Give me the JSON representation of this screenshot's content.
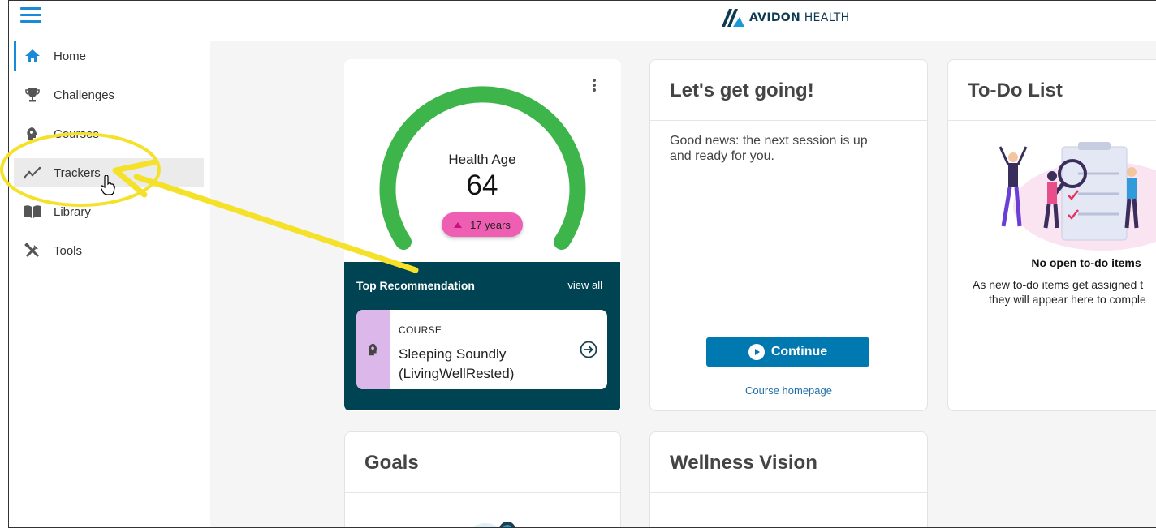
{
  "brand": {
    "name_bold": "AVIDON",
    "name_light": " HEALTH"
  },
  "sidebar": {
    "items": [
      {
        "label": "Home",
        "icon": "home-icon"
      },
      {
        "label": "Challenges",
        "icon": "trophy-icon"
      },
      {
        "label": "Courses",
        "icon": "brain-head-icon"
      },
      {
        "label": "Trackers",
        "icon": "trend-line-icon"
      },
      {
        "label": "Library",
        "icon": "book-icon"
      },
      {
        "label": "Tools",
        "icon": "tools-icon"
      }
    ]
  },
  "health_age": {
    "label": "Health Age",
    "value": "64",
    "delta": "17 years",
    "gauge_color": "#3db54a"
  },
  "recommendation": {
    "title": "Top Recommendation",
    "link": "view all",
    "type": "COURSE",
    "name_line1": "Sleeping Soundly",
    "name_line2": "(LivingWellRested)"
  },
  "lets_get_going": {
    "title": "Let's get going!",
    "line1": "Good news: the next session is up",
    "line2": "and ready for you.",
    "button": "Continue",
    "link": "Course homepage"
  },
  "todo": {
    "title": "To-Do List",
    "empty_title": "No open to-do items",
    "empty_line1": "As new to-do items get assigned t",
    "empty_line2": "they will appear here to comple"
  },
  "goals": {
    "title": "Goals"
  },
  "wellness_vision": {
    "title": "Wellness Vision"
  },
  "colors": {
    "accent": "#1a8bd6",
    "dark_teal": "#004352",
    "button": "#0078b0",
    "highlight": "#f5e12a"
  }
}
